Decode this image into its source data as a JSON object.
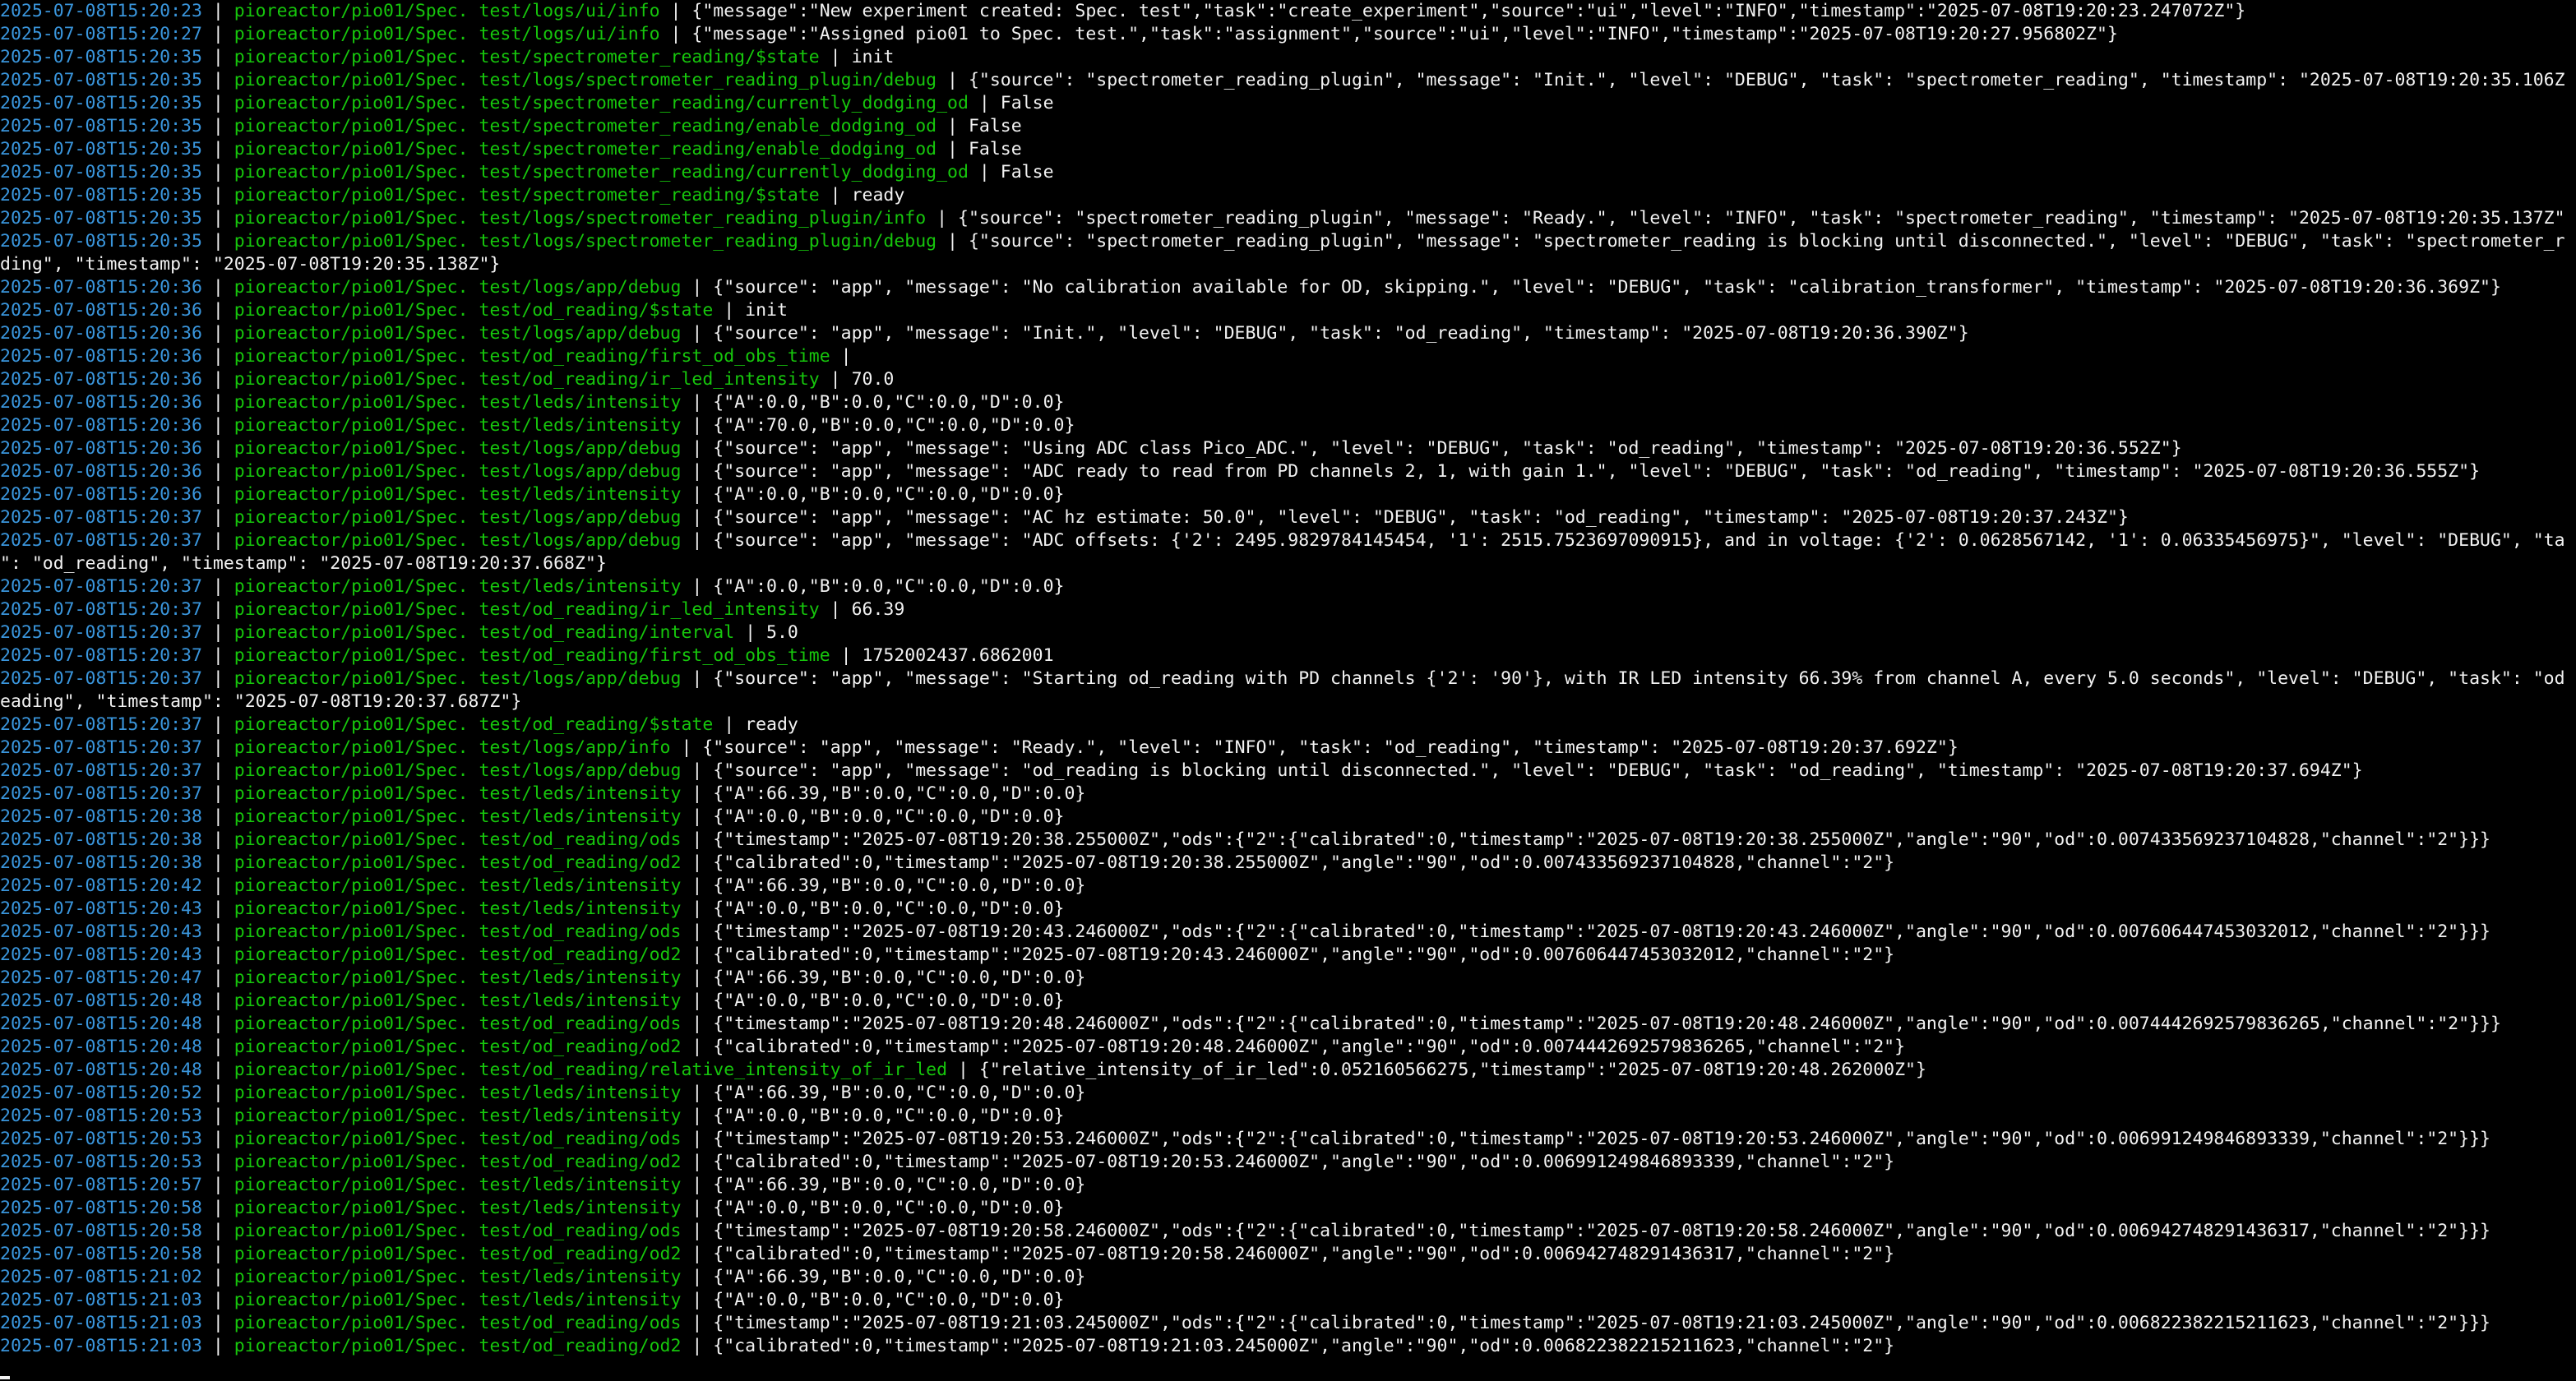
{
  "colors": {
    "background": "#000000",
    "timestamp": "#3a96dd",
    "topic": "#16c60c",
    "text": "#f2f2f2"
  },
  "lines": [
    {
      "ts": "2025-07-08T15:20:23",
      "topic": "pioreactor/pio01/Spec. test/logs/ui/info",
      "msg": "{\"message\":\"New experiment created: Spec. test\",\"task\":\"create_experiment\",\"source\":\"ui\",\"level\":\"INFO\",\"timestamp\":\"2025-07-08T19:20:23.247072Z\"}"
    },
    {
      "ts": "2025-07-08T15:20:27",
      "topic": "pioreactor/pio01/Spec. test/logs/ui/info",
      "msg": "{\"message\":\"Assigned pio01 to Spec. test.\",\"task\":\"assignment\",\"source\":\"ui\",\"level\":\"INFO\",\"timestamp\":\"2025-07-08T19:20:27.956802Z\"}"
    },
    {
      "ts": "2025-07-08T15:20:35",
      "topic": "pioreactor/pio01/Spec. test/spectrometer_reading/$state",
      "msg": "init"
    },
    {
      "ts": "2025-07-08T15:20:35",
      "topic": "pioreactor/pio01/Spec. test/logs/spectrometer_reading_plugin/debug",
      "msg": "{\"source\": \"spectrometer_reading_plugin\", \"message\": \"Init.\", \"level\": \"DEBUG\", \"task\": \"spectrometer_reading\", \"timestamp\": \"2025-07-08T19:20:35.106Z"
    },
    {
      "ts": "2025-07-08T15:20:35",
      "topic": "pioreactor/pio01/Spec. test/spectrometer_reading/currently_dodging_od",
      "msg": "False"
    },
    {
      "ts": "2025-07-08T15:20:35",
      "topic": "pioreactor/pio01/Spec. test/spectrometer_reading/enable_dodging_od",
      "msg": "False"
    },
    {
      "ts": "2025-07-08T15:20:35",
      "topic": "pioreactor/pio01/Spec. test/spectrometer_reading/enable_dodging_od",
      "msg": "False"
    },
    {
      "ts": "2025-07-08T15:20:35",
      "topic": "pioreactor/pio01/Spec. test/spectrometer_reading/currently_dodging_od",
      "msg": "False"
    },
    {
      "ts": "2025-07-08T15:20:35",
      "topic": "pioreactor/pio01/Spec. test/spectrometer_reading/$state",
      "msg": "ready"
    },
    {
      "ts": "2025-07-08T15:20:35",
      "topic": "pioreactor/pio01/Spec. test/logs/spectrometer_reading_plugin/info",
      "msg": "{\"source\": \"spectrometer_reading_plugin\", \"message\": \"Ready.\", \"level\": \"INFO\", \"task\": \"spectrometer_reading\", \"timestamp\": \"2025-07-08T19:20:35.137Z\""
    },
    {
      "ts": "2025-07-08T15:20:35",
      "topic": "pioreactor/pio01/Spec. test/logs/spectrometer_reading_plugin/debug",
      "msg": "{\"source\": \"spectrometer_reading_plugin\", \"message\": \"spectrometer_reading is blocking until disconnected.\", \"level\": \"DEBUG\", \"task\": \"spectrometer_r"
    },
    {
      "cont": "ding\", \"timestamp\": \"2025-07-08T19:20:35.138Z\"}"
    },
    {
      "ts": "2025-07-08T15:20:36",
      "topic": "pioreactor/pio01/Spec. test/logs/app/debug",
      "msg": "{\"source\": \"app\", \"message\": \"No calibration available for OD, skipping.\", \"level\": \"DEBUG\", \"task\": \"calibration_transformer\", \"timestamp\": \"2025-07-08T19:20:36.369Z\"}"
    },
    {
      "ts": "2025-07-08T15:20:36",
      "topic": "pioreactor/pio01/Spec. test/od_reading/$state",
      "msg": "init"
    },
    {
      "ts": "2025-07-08T15:20:36",
      "topic": "pioreactor/pio01/Spec. test/logs/app/debug",
      "msg": "{\"source\": \"app\", \"message\": \"Init.\", \"level\": \"DEBUG\", \"task\": \"od_reading\", \"timestamp\": \"2025-07-08T19:20:36.390Z\"}"
    },
    {
      "ts": "2025-07-08T15:20:36",
      "topic": "pioreactor/pio01/Spec. test/od_reading/first_od_obs_time",
      "msg": ""
    },
    {
      "ts": "2025-07-08T15:20:36",
      "topic": "pioreactor/pio01/Spec. test/od_reading/ir_led_intensity",
      "msg": "70.0"
    },
    {
      "ts": "2025-07-08T15:20:36",
      "topic": "pioreactor/pio01/Spec. test/leds/intensity",
      "msg": "{\"A\":0.0,\"B\":0.0,\"C\":0.0,\"D\":0.0}"
    },
    {
      "ts": "2025-07-08T15:20:36",
      "topic": "pioreactor/pio01/Spec. test/leds/intensity",
      "msg": "{\"A\":70.0,\"B\":0.0,\"C\":0.0,\"D\":0.0}"
    },
    {
      "ts": "2025-07-08T15:20:36",
      "topic": "pioreactor/pio01/Spec. test/logs/app/debug",
      "msg": "{\"source\": \"app\", \"message\": \"Using ADC class Pico_ADC.\", \"level\": \"DEBUG\", \"task\": \"od_reading\", \"timestamp\": \"2025-07-08T19:20:36.552Z\"}"
    },
    {
      "ts": "2025-07-08T15:20:36",
      "topic": "pioreactor/pio01/Spec. test/logs/app/debug",
      "msg": "{\"source\": \"app\", \"message\": \"ADC ready to read from PD channels 2, 1, with gain 1.\", \"level\": \"DEBUG\", \"task\": \"od_reading\", \"timestamp\": \"2025-07-08T19:20:36.555Z\"}"
    },
    {
      "ts": "2025-07-08T15:20:36",
      "topic": "pioreactor/pio01/Spec. test/leds/intensity",
      "msg": "{\"A\":0.0,\"B\":0.0,\"C\":0.0,\"D\":0.0}"
    },
    {
      "ts": "2025-07-08T15:20:37",
      "topic": "pioreactor/pio01/Spec. test/logs/app/debug",
      "msg": "{\"source\": \"app\", \"message\": \"AC hz estimate: 50.0\", \"level\": \"DEBUG\", \"task\": \"od_reading\", \"timestamp\": \"2025-07-08T19:20:37.243Z\"}"
    },
    {
      "ts": "2025-07-08T15:20:37",
      "topic": "pioreactor/pio01/Spec. test/logs/app/debug",
      "msg": "{\"source\": \"app\", \"message\": \"ADC offsets: {'2': 2495.9829784145454, '1': 2515.7523697090915}, and in voltage: {'2': 0.0628567142, '1': 0.06335456975}\", \"level\": \"DEBUG\", \"ta"
    },
    {
      "cont": "\": \"od_reading\", \"timestamp\": \"2025-07-08T19:20:37.668Z\"}"
    },
    {
      "ts": "2025-07-08T15:20:37",
      "topic": "pioreactor/pio01/Spec. test/leds/intensity",
      "msg": "{\"A\":0.0,\"B\":0.0,\"C\":0.0,\"D\":0.0}"
    },
    {
      "ts": "2025-07-08T15:20:37",
      "topic": "pioreactor/pio01/Spec. test/od_reading/ir_led_intensity",
      "msg": "66.39"
    },
    {
      "ts": "2025-07-08T15:20:37",
      "topic": "pioreactor/pio01/Spec. test/od_reading/interval",
      "msg": "5.0"
    },
    {
      "ts": "2025-07-08T15:20:37",
      "topic": "pioreactor/pio01/Spec. test/od_reading/first_od_obs_time",
      "msg": "1752002437.6862001"
    },
    {
      "ts": "2025-07-08T15:20:37",
      "topic": "pioreactor/pio01/Spec. test/logs/app/debug",
      "msg": "{\"source\": \"app\", \"message\": \"Starting od_reading with PD channels {'2': '90'}, with IR LED intensity 66.39% from channel A, every 5.0 seconds\", \"level\": \"DEBUG\", \"task\": \"od"
    },
    {
      "cont": "eading\", \"timestamp\": \"2025-07-08T19:20:37.687Z\"}"
    },
    {
      "ts": "2025-07-08T15:20:37",
      "topic": "pioreactor/pio01/Spec. test/od_reading/$state",
      "msg": "ready"
    },
    {
      "ts": "2025-07-08T15:20:37",
      "topic": "pioreactor/pio01/Spec. test/logs/app/info",
      "msg": "{\"source\": \"app\", \"message\": \"Ready.\", \"level\": \"INFO\", \"task\": \"od_reading\", \"timestamp\": \"2025-07-08T19:20:37.692Z\"}"
    },
    {
      "ts": "2025-07-08T15:20:37",
      "topic": "pioreactor/pio01/Spec. test/logs/app/debug",
      "msg": "{\"source\": \"app\", \"message\": \"od_reading is blocking until disconnected.\", \"level\": \"DEBUG\", \"task\": \"od_reading\", \"timestamp\": \"2025-07-08T19:20:37.694Z\"}"
    },
    {
      "ts": "2025-07-08T15:20:37",
      "topic": "pioreactor/pio01/Spec. test/leds/intensity",
      "msg": "{\"A\":66.39,\"B\":0.0,\"C\":0.0,\"D\":0.0}"
    },
    {
      "ts": "2025-07-08T15:20:38",
      "topic": "pioreactor/pio01/Spec. test/leds/intensity",
      "msg": "{\"A\":0.0,\"B\":0.0,\"C\":0.0,\"D\":0.0}"
    },
    {
      "ts": "2025-07-08T15:20:38",
      "topic": "pioreactor/pio01/Spec. test/od_reading/ods",
      "msg": "{\"timestamp\":\"2025-07-08T19:20:38.255000Z\",\"ods\":{\"2\":{\"calibrated\":0,\"timestamp\":\"2025-07-08T19:20:38.255000Z\",\"angle\":\"90\",\"od\":0.007433569237104828,\"channel\":\"2\"}}}"
    },
    {
      "ts": "2025-07-08T15:20:38",
      "topic": "pioreactor/pio01/Spec. test/od_reading/od2",
      "msg": "{\"calibrated\":0,\"timestamp\":\"2025-07-08T19:20:38.255000Z\",\"angle\":\"90\",\"od\":0.007433569237104828,\"channel\":\"2\"}"
    },
    {
      "ts": "2025-07-08T15:20:42",
      "topic": "pioreactor/pio01/Spec. test/leds/intensity",
      "msg": "{\"A\":66.39,\"B\":0.0,\"C\":0.0,\"D\":0.0}"
    },
    {
      "ts": "2025-07-08T15:20:43",
      "topic": "pioreactor/pio01/Spec. test/leds/intensity",
      "msg": "{\"A\":0.0,\"B\":0.0,\"C\":0.0,\"D\":0.0}"
    },
    {
      "ts": "2025-07-08T15:20:43",
      "topic": "pioreactor/pio01/Spec. test/od_reading/ods",
      "msg": "{\"timestamp\":\"2025-07-08T19:20:43.246000Z\",\"ods\":{\"2\":{\"calibrated\":0,\"timestamp\":\"2025-07-08T19:20:43.246000Z\",\"angle\":\"90\",\"od\":0.007606447453032012,\"channel\":\"2\"}}}"
    },
    {
      "ts": "2025-07-08T15:20:43",
      "topic": "pioreactor/pio01/Spec. test/od_reading/od2",
      "msg": "{\"calibrated\":0,\"timestamp\":\"2025-07-08T19:20:43.246000Z\",\"angle\":\"90\",\"od\":0.007606447453032012,\"channel\":\"2\"}"
    },
    {
      "ts": "2025-07-08T15:20:47",
      "topic": "pioreactor/pio01/Spec. test/leds/intensity",
      "msg": "{\"A\":66.39,\"B\":0.0,\"C\":0.0,\"D\":0.0}"
    },
    {
      "ts": "2025-07-08T15:20:48",
      "topic": "pioreactor/pio01/Spec. test/leds/intensity",
      "msg": "{\"A\":0.0,\"B\":0.0,\"C\":0.0,\"D\":0.0}"
    },
    {
      "ts": "2025-07-08T15:20:48",
      "topic": "pioreactor/pio01/Spec. test/od_reading/ods",
      "msg": "{\"timestamp\":\"2025-07-08T19:20:48.246000Z\",\"ods\":{\"2\":{\"calibrated\":0,\"timestamp\":\"2025-07-08T19:20:48.246000Z\",\"angle\":\"90\",\"od\":0.0074442692579836265,\"channel\":\"2\"}}}"
    },
    {
      "ts": "2025-07-08T15:20:48",
      "topic": "pioreactor/pio01/Spec. test/od_reading/od2",
      "msg": "{\"calibrated\":0,\"timestamp\":\"2025-07-08T19:20:48.246000Z\",\"angle\":\"90\",\"od\":0.0074442692579836265,\"channel\":\"2\"}"
    },
    {
      "ts": "2025-07-08T15:20:48",
      "topic": "pioreactor/pio01/Spec. test/od_reading/relative_intensity_of_ir_led",
      "msg": "{\"relative_intensity_of_ir_led\":0.052160566275,\"timestamp\":\"2025-07-08T19:20:48.262000Z\"}"
    },
    {
      "ts": "2025-07-08T15:20:52",
      "topic": "pioreactor/pio01/Spec. test/leds/intensity",
      "msg": "{\"A\":66.39,\"B\":0.0,\"C\":0.0,\"D\":0.0}"
    },
    {
      "ts": "2025-07-08T15:20:53",
      "topic": "pioreactor/pio01/Spec. test/leds/intensity",
      "msg": "{\"A\":0.0,\"B\":0.0,\"C\":0.0,\"D\":0.0}"
    },
    {
      "ts": "2025-07-08T15:20:53",
      "topic": "pioreactor/pio01/Spec. test/od_reading/ods",
      "msg": "{\"timestamp\":\"2025-07-08T19:20:53.246000Z\",\"ods\":{\"2\":{\"calibrated\":0,\"timestamp\":\"2025-07-08T19:20:53.246000Z\",\"angle\":\"90\",\"od\":0.006991249846893339,\"channel\":\"2\"}}}"
    },
    {
      "ts": "2025-07-08T15:20:53",
      "topic": "pioreactor/pio01/Spec. test/od_reading/od2",
      "msg": "{\"calibrated\":0,\"timestamp\":\"2025-07-08T19:20:53.246000Z\",\"angle\":\"90\",\"od\":0.006991249846893339,\"channel\":\"2\"}"
    },
    {
      "ts": "2025-07-08T15:20:57",
      "topic": "pioreactor/pio01/Spec. test/leds/intensity",
      "msg": "{\"A\":66.39,\"B\":0.0,\"C\":0.0,\"D\":0.0}"
    },
    {
      "ts": "2025-07-08T15:20:58",
      "topic": "pioreactor/pio01/Spec. test/leds/intensity",
      "msg": "{\"A\":0.0,\"B\":0.0,\"C\":0.0,\"D\":0.0}"
    },
    {
      "ts": "2025-07-08T15:20:58",
      "topic": "pioreactor/pio01/Spec. test/od_reading/ods",
      "msg": "{\"timestamp\":\"2025-07-08T19:20:58.246000Z\",\"ods\":{\"2\":{\"calibrated\":0,\"timestamp\":\"2025-07-08T19:20:58.246000Z\",\"angle\":\"90\",\"od\":0.006942748291436317,\"channel\":\"2\"}}}"
    },
    {
      "ts": "2025-07-08T15:20:58",
      "topic": "pioreactor/pio01/Spec. test/od_reading/od2",
      "msg": "{\"calibrated\":0,\"timestamp\":\"2025-07-08T19:20:58.246000Z\",\"angle\":\"90\",\"od\":0.006942748291436317,\"channel\":\"2\"}"
    },
    {
      "ts": "2025-07-08T15:21:02",
      "topic": "pioreactor/pio01/Spec. test/leds/intensity",
      "msg": "{\"A\":66.39,\"B\":0.0,\"C\":0.0,\"D\":0.0}"
    },
    {
      "ts": "2025-07-08T15:21:03",
      "topic": "pioreactor/pio01/Spec. test/leds/intensity",
      "msg": "{\"A\":0.0,\"B\":0.0,\"C\":0.0,\"D\":0.0}"
    },
    {
      "ts": "2025-07-08T15:21:03",
      "topic": "pioreactor/pio01/Spec. test/od_reading/ods",
      "msg": "{\"timestamp\":\"2025-07-08T19:21:03.245000Z\",\"ods\":{\"2\":{\"calibrated\":0,\"timestamp\":\"2025-07-08T19:21:03.245000Z\",\"angle\":\"90\",\"od\":0.006822382215211623,\"channel\":\"2\"}}}"
    },
    {
      "ts": "2025-07-08T15:21:03",
      "topic": "pioreactor/pio01/Spec. test/od_reading/od2",
      "msg": "{\"calibrated\":0,\"timestamp\":\"2025-07-08T19:21:03.245000Z\",\"angle\":\"90\",\"od\":0.006822382215211623,\"channel\":\"2\"}"
    }
  ]
}
